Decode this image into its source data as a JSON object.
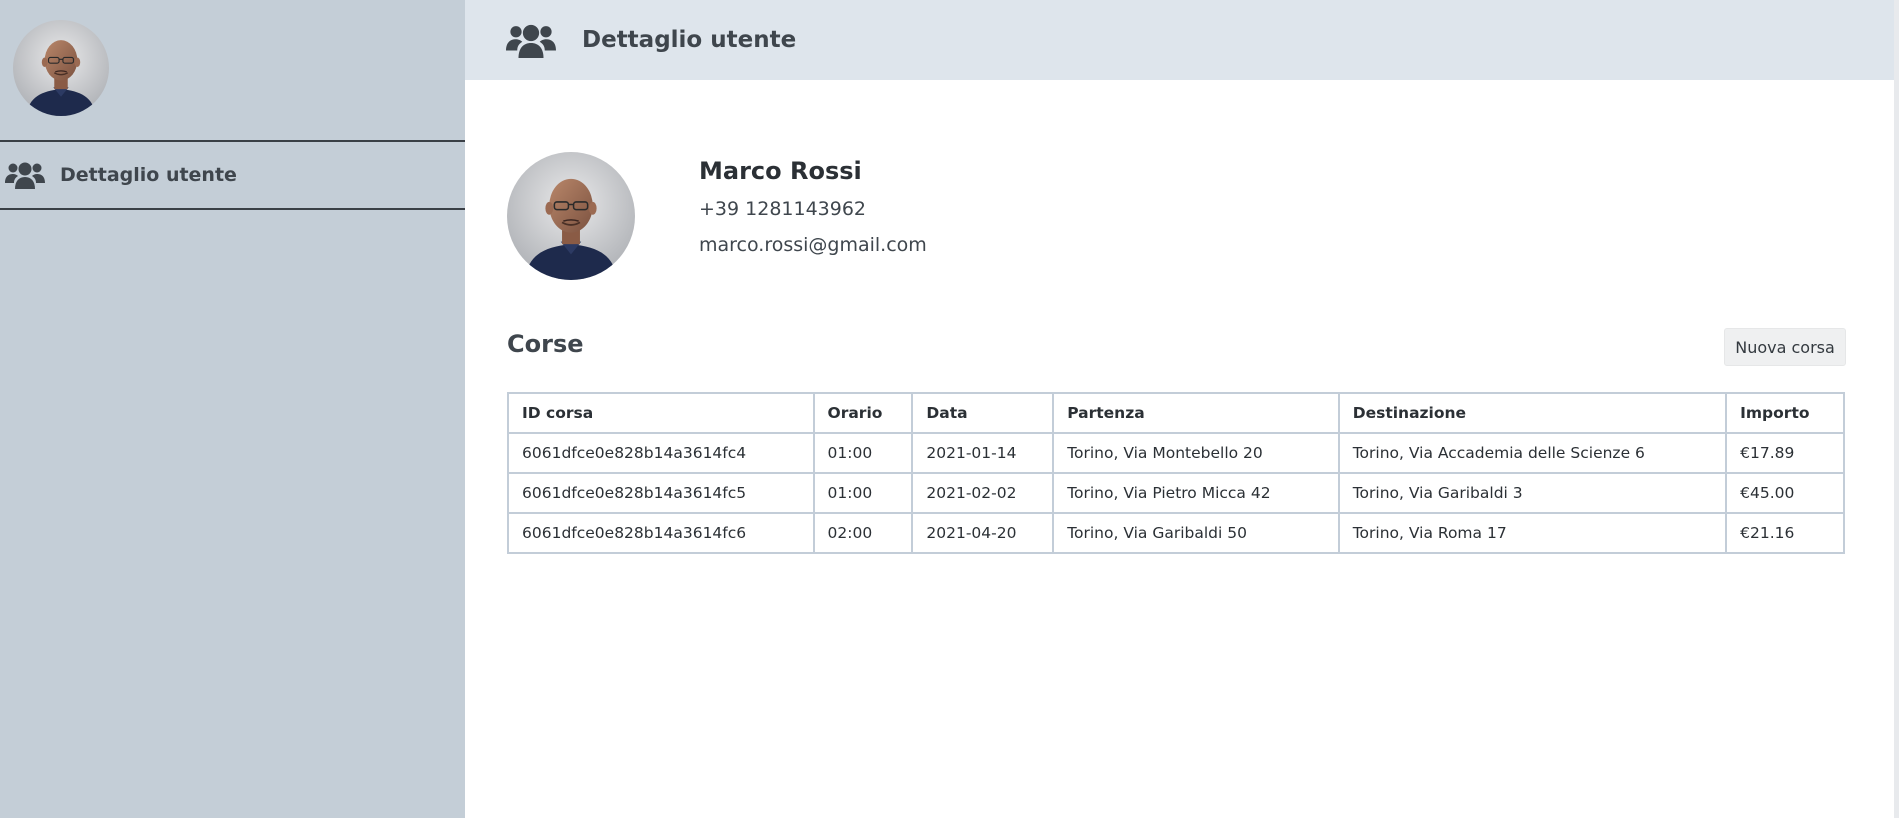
{
  "sidebar": {
    "avatar_alt": "Marco Rossi",
    "nav": [
      {
        "label": "Dettaglio utente",
        "icon": "users-icon"
      }
    ]
  },
  "header": {
    "title": "Dettaglio utente",
    "icon": "users-icon"
  },
  "profile": {
    "name": "Marco Rossi",
    "phone": "+39 1281143962",
    "email": "marco.rossi@gmail.com"
  },
  "rides": {
    "title": "Corse",
    "new_button": "Nuova corsa",
    "columns": [
      "ID corsa",
      "Orario",
      "Data",
      "Partenza",
      "Destinazione",
      "Importo"
    ],
    "rows": [
      [
        "6061dfce0e828b14a3614fc4",
        "01:00",
        "2021-01-14",
        "Torino, Via Montebello 20",
        "Torino, Via Accademia delle Scienze 6",
        "€17.89"
      ],
      [
        "6061dfce0e828b14a3614fc5",
        "01:00",
        "2021-02-02",
        "Torino, Via Pietro Micca 42",
        "Torino, Via Garibaldi 3",
        "€45.00"
      ],
      [
        "6061dfce0e828b14a3614fc6",
        "02:00",
        "2021-04-20",
        "Torino, Via Garibaldi 50",
        "Torino, Via Roma 17",
        "€21.16"
      ]
    ]
  },
  "colors": {
    "sidebar_bg": "#c4ced7",
    "header_bg": "#dee5ec",
    "table_border": "#c3cdd8",
    "text": "#343a40"
  }
}
